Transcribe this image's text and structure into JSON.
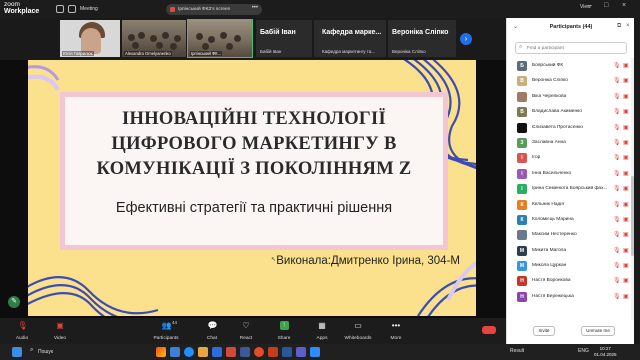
{
  "app": {
    "brand_line1": "zoom",
    "brand_line2": "Workplace",
    "meeting_label": "Meeting"
  },
  "share_banner": {
    "text": "Ірпінський ФКЗ's screen",
    "more": "•••"
  },
  "window_controls": [
    "–",
    "□",
    "×"
  ],
  "thumbnails": [
    {
      "name": "Юлія Гаврилюк"
    },
    {
      "name": "Alexandra Omelyanenko"
    },
    {
      "name": "Ірпінський ФК..."
    }
  ],
  "participant_tiles": [
    {
      "name": "Бабій Іван",
      "sub": "Бабій Іван"
    },
    {
      "name": "Кафедра марке...",
      "sub": "Кафедра маркетингу та..."
    },
    {
      "name": "Вероніка Сліпко",
      "sub": "Вероніка Сліпко"
    }
  ],
  "slide": {
    "title_lines": [
      "ІННОВАЦІЙНІ ТЕХНОЛОГІЇ",
      "ЦИФРОВОГО МАРКЕТИНГУ В",
      "КОМУНІКАЦІЇ З ПОКОЛІННЯМ Z"
    ],
    "subtitle": "Ефективні стратегії та практичні рішення",
    "author": "Виконала:Дмитренко Ірина, 304-М"
  },
  "toolbar": {
    "audio": "Audio",
    "video": "Video",
    "participants": "Participants",
    "participants_count": "44",
    "chat": "Chat",
    "react": "React",
    "share": "Share",
    "apps": "Apps",
    "whiteboards": "Whiteboards",
    "more": "More",
    "leave": "Leave"
  },
  "panel": {
    "title": "Participants (44)",
    "search_placeholder": "Find a participant",
    "invite": "Invite",
    "mute_me": "Unmute me",
    "participants": [
      {
        "initial": "Б",
        "name": "Боярський ФК",
        "color": "#5b6b7b"
      },
      {
        "initial": "В",
        "name": "Вероніка Сліпко",
        "color": "#c9b07a"
      },
      {
        "initial": "",
        "name": "Віка Черепкова",
        "color": "#a07a64"
      },
      {
        "initial": "В",
        "name": "Владислава Акименко",
        "color": "#7e7a56"
      },
      {
        "initial": "",
        "name": "Єлизавета Протасенко",
        "color": "#111111"
      },
      {
        "initial": "З",
        "name": "Заславна Анна",
        "color": "#5a9a5a"
      },
      {
        "initial": "І",
        "name": "Ігор",
        "color": "#d9534f"
      },
      {
        "initial": "І",
        "name": "Інна Васильченко",
        "color": "#9b59b6"
      },
      {
        "initial": "І",
        "name": "Ірина Семенюта Боярський фах...",
        "color": "#27ae60"
      },
      {
        "initial": "К",
        "name": "Кельник Надія",
        "color": "#e67e22"
      },
      {
        "initial": "К",
        "name": "Коломієць Марина",
        "color": "#2980b9"
      },
      {
        "initial": "",
        "name": "Максим Нестеренко",
        "color": "#6a7a8a"
      },
      {
        "initial": "М",
        "name": "Микита Магола",
        "color": "#2c3e50"
      },
      {
        "initial": "М",
        "name": "Микола Цуркан",
        "color": "#3498db"
      },
      {
        "initial": "Н",
        "name": "Настя Воронкова",
        "color": "#c0392b"
      },
      {
        "initial": "Н",
        "name": "Настя Бережецька",
        "color": "#8e44ad"
      }
    ]
  },
  "taskbar": {
    "search_label": "Пошук",
    "result": "Result",
    "lang": "ENG",
    "time": "10:27",
    "date": "01.04.2025",
    "view": "View"
  },
  "colors": {
    "slide_bg": "#fbe08d",
    "card_border": "#f2c6d4",
    "swirl_blue": "#3b4db3",
    "accent_blue": "#1f6feb",
    "leave_red": "#e5433d"
  }
}
